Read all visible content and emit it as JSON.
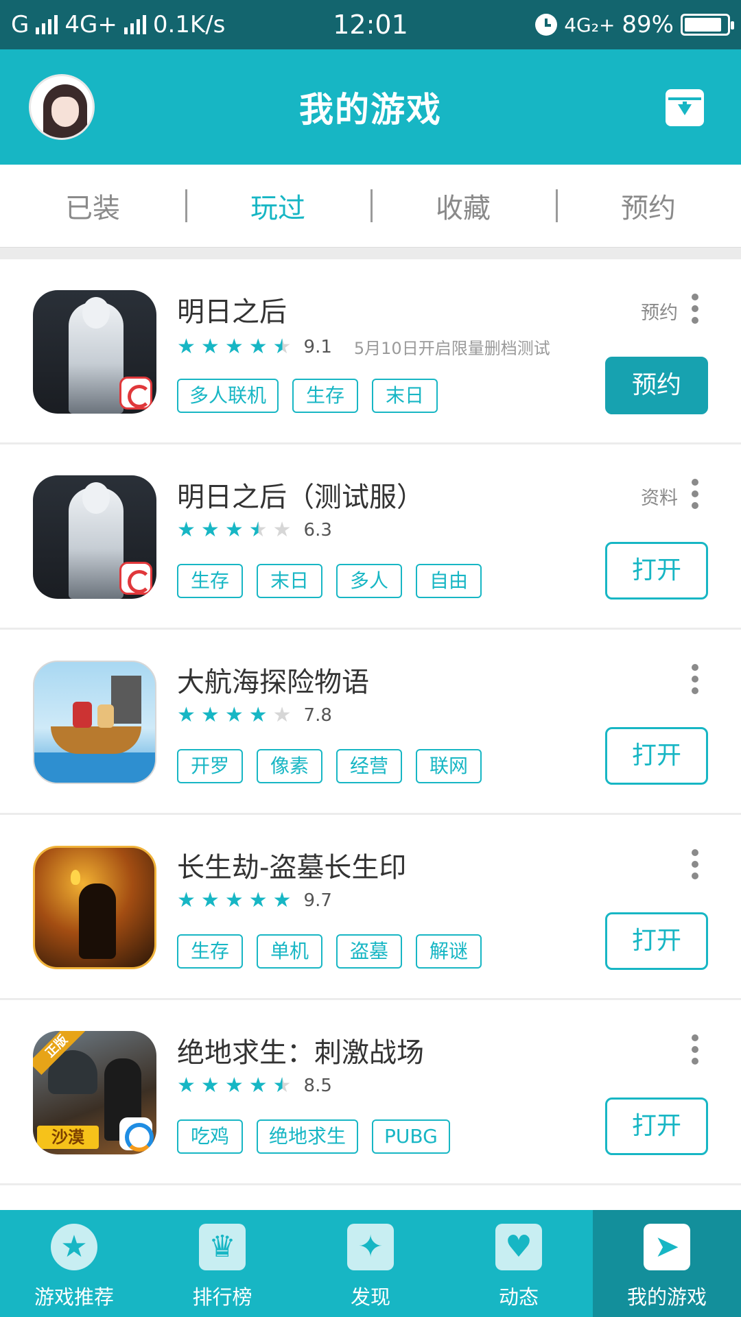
{
  "status_bar": {
    "carrier1": "G",
    "network": "4G+",
    "speed": "0.1K/s",
    "time": "12:01",
    "network2": "4G₂+",
    "battery": "89%",
    "battery_level": 0.89
  },
  "header": {
    "title": "我的游戏"
  },
  "tabs": [
    {
      "label": "已装",
      "active": false
    },
    {
      "label": "玩过",
      "active": true
    },
    {
      "label": "收藏",
      "active": false
    },
    {
      "label": "预约",
      "active": false
    }
  ],
  "games": [
    {
      "name": "明日之后",
      "rating": 9.1,
      "score_text": "9.1",
      "stars": [
        1,
        1,
        1,
        1,
        0.5
      ],
      "note": "5月10日开启限量删档测试",
      "tags": [
        "多人联机",
        "生存",
        "末日"
      ],
      "side_label": "预约",
      "action": "预约",
      "icon": "mingri-icon"
    },
    {
      "name": "明日之后（测试服）",
      "rating": 6.3,
      "score_text": "6.3",
      "stars": [
        1,
        1,
        1,
        0.5,
        0
      ],
      "note": "",
      "tags": [
        "生存",
        "末日",
        "多人",
        "自由"
      ],
      "side_label": "资料",
      "action": "打开",
      "icon": "mingri-test-icon"
    },
    {
      "name": "大航海探险物语",
      "rating": 7.8,
      "score_text": "7.8",
      "stars": [
        1,
        1,
        1,
        1,
        0
      ],
      "note": "",
      "tags": [
        "开罗",
        "像素",
        "经营",
        "联网"
      ],
      "side_label": "",
      "action": "打开",
      "icon": "pirate-ship-icon"
    },
    {
      "name": "长生劫-盗墓长生印",
      "rating": 9.7,
      "score_text": "9.7",
      "stars": [
        1,
        1,
        1,
        1,
        1
      ],
      "note": "",
      "tags": [
        "生存",
        "单机",
        "盗墓",
        "解谜"
      ],
      "side_label": "",
      "action": "打开",
      "icon": "tomb-raider-icon"
    },
    {
      "name": "绝地求生：刺激战场",
      "rating": 8.5,
      "score_text": "8.5",
      "stars": [
        1,
        1,
        1,
        1,
        0.5
      ],
      "note": "",
      "tags": [
        "吃鸡",
        "绝地求生",
        "PUBG"
      ],
      "side_label": "",
      "action": "打开",
      "icon": "pubg-icon",
      "icon_ribbon": "正版",
      "icon_badge": "沙漠"
    }
  ],
  "bottom_nav": [
    {
      "label": "游戏推荐",
      "icon": "star-icon",
      "active": false
    },
    {
      "label": "排行榜",
      "icon": "trophy-icon",
      "active": false
    },
    {
      "label": "发现",
      "icon": "sparkle-icon",
      "active": false
    },
    {
      "label": "动态",
      "icon": "heart-icon",
      "active": false
    },
    {
      "label": "我的游戏",
      "icon": "paper-plane-icon",
      "active": true
    }
  ],
  "colors": {
    "status_bar": "#13656e",
    "primary": "#17b6c4",
    "primary_dark": "#138f9b"
  }
}
